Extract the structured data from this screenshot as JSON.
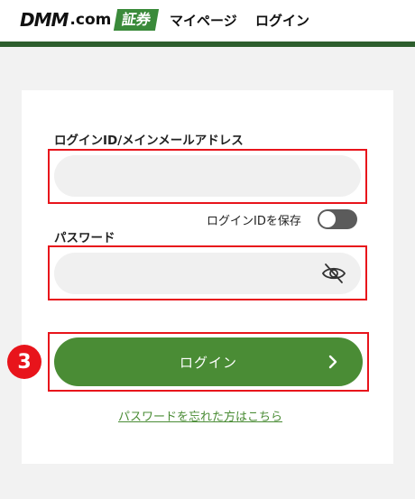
{
  "header": {
    "logo_dmm": "DMM",
    "logo_com": ".com",
    "logo_securities": "証券",
    "nav_mypage": "マイページ",
    "nav_login": "ログイン",
    "accent_color": "#2d5e2d"
  },
  "form": {
    "id_label": "ログインID/メインメールアドレス",
    "id_value": "",
    "save_id_label": "ログインIDを保存",
    "save_id_on": false,
    "password_label": "パスワード",
    "password_value": "",
    "password_visibility_icon": "eye-slash-icon",
    "login_button_label": "ログイン",
    "login_button_icon": "chevron-right-icon",
    "login_button_color": "#4a8c35",
    "forgot_password_link": "パスワードを忘れた方はこちら"
  },
  "annotation": {
    "step_number": "3",
    "highlight_color": "#e8141b"
  }
}
